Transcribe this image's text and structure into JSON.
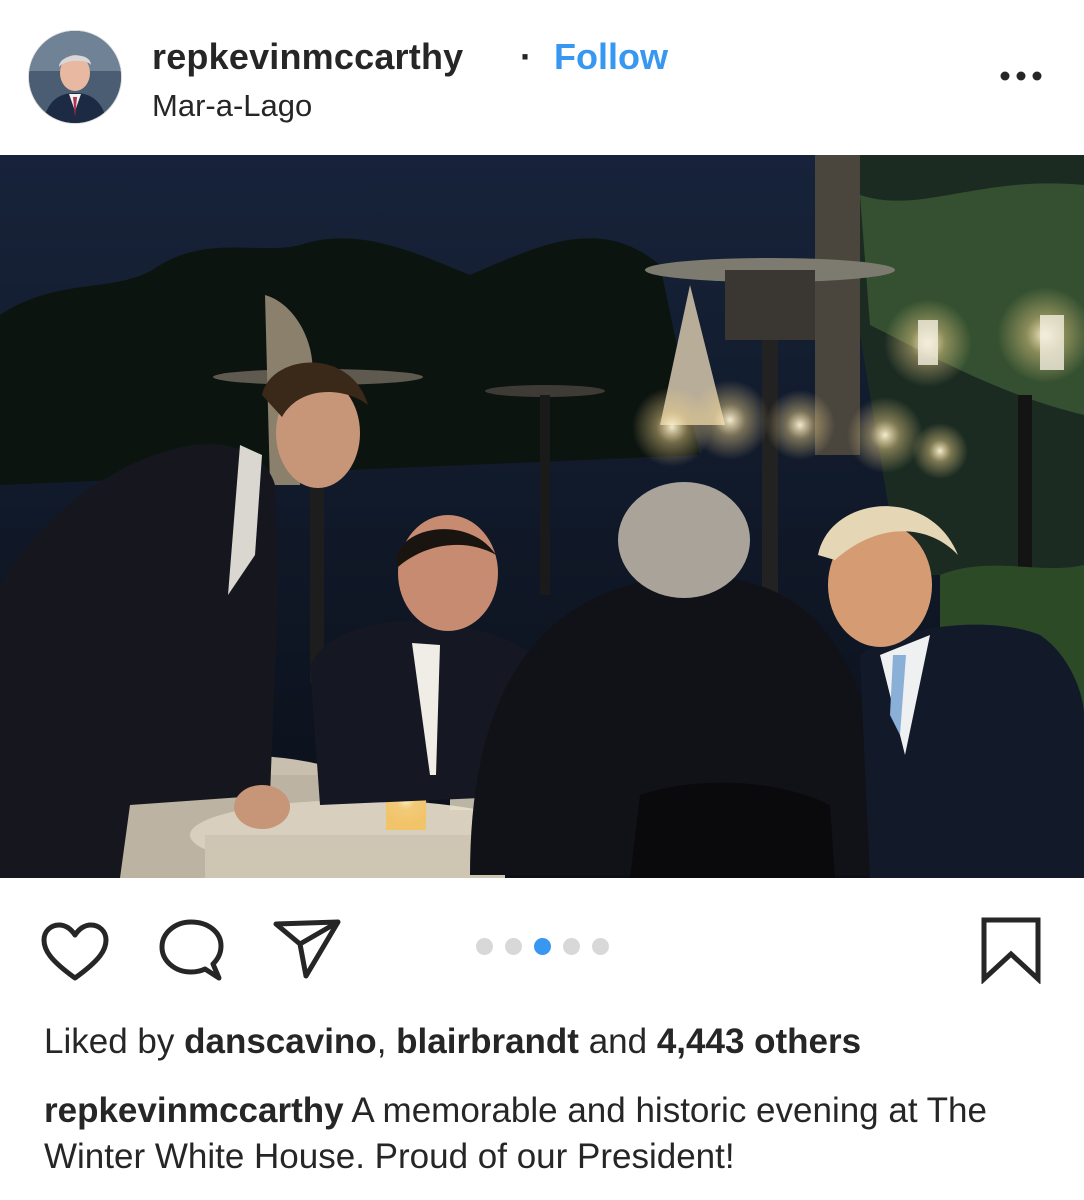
{
  "post": {
    "username": "repkevinmccarthy",
    "separator": "·",
    "follow_label": "Follow",
    "location": "Mar-a-Lago",
    "more_icon": "more-options-icon"
  },
  "carousel": {
    "total": 5,
    "active_index": 2,
    "active_color": "#3897f0",
    "inactive_color": "#d8d8d8"
  },
  "actions": {
    "like_icon": "heart-icon",
    "comment_icon": "comment-icon",
    "share_icon": "send-icon",
    "save_icon": "bookmark-icon"
  },
  "likes": {
    "prefix": "Liked by",
    "user1": "danscavino",
    "sep": ",",
    "user2": "blairbrandt",
    "and": "and",
    "count": "4,443 others"
  },
  "caption": {
    "username": "repkevinmccarthy",
    "text": "A memorable and historic evening at The Winter White House. Proud of our President!"
  },
  "colors": {
    "link_blue": "#3897f0",
    "text": "#262626"
  }
}
